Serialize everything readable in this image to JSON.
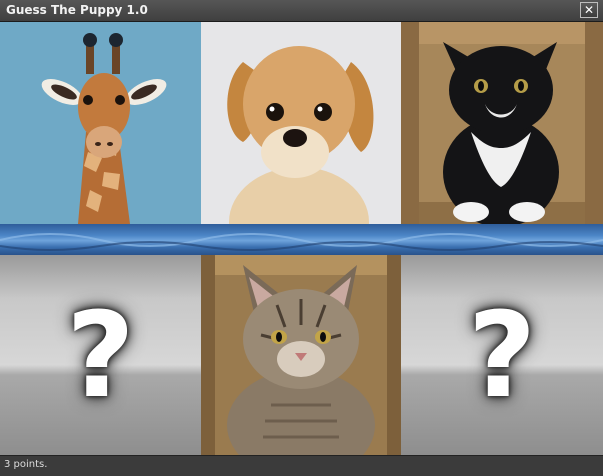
{
  "window": {
    "title": "Guess The Puppy 1.0",
    "close_icon": "close-icon"
  },
  "tiles": {
    "top": [
      {
        "subject": "giraffe",
        "revealed": true
      },
      {
        "subject": "puppy",
        "revealed": true
      },
      {
        "subject": "tuxedo cat",
        "revealed": true
      }
    ],
    "bottom": [
      {
        "subject": "hidden",
        "revealed": false,
        "glyph": "?"
      },
      {
        "subject": "tabby cat",
        "revealed": true
      },
      {
        "subject": "hidden",
        "revealed": false,
        "glyph": "?"
      }
    ]
  },
  "colors": {
    "giraffe_bg": "#6fa9c6",
    "puppy_bg": "#e6e6e8",
    "box_brown": "#9a7b4f",
    "divider_blue": "#4c86c7"
  },
  "status": {
    "text": "3 points."
  }
}
